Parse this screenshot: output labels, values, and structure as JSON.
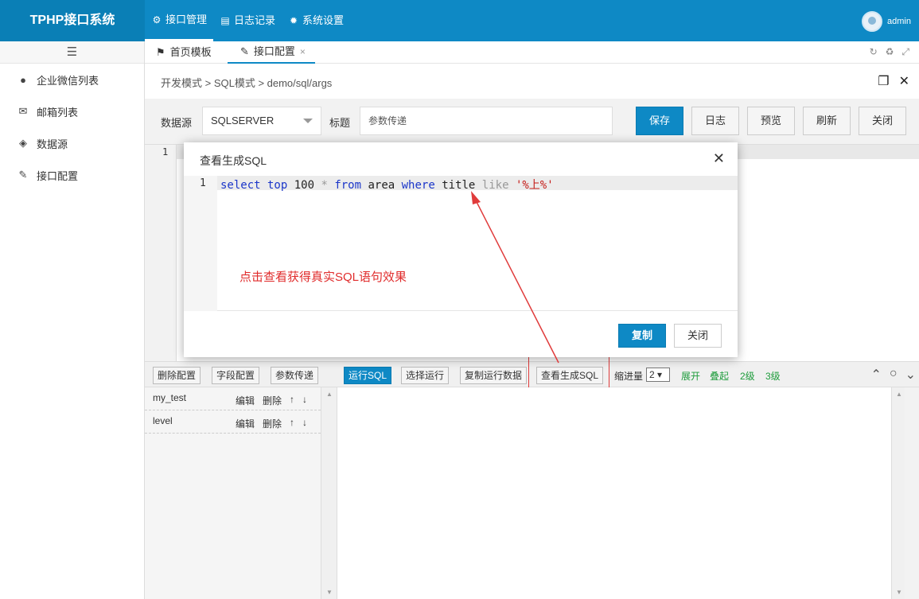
{
  "app": {
    "title": "TPHP接口系统",
    "user": "admin"
  },
  "topnav": [
    {
      "label": "接口管理",
      "icon": "gears-icon",
      "active": true
    },
    {
      "label": "日志记录",
      "icon": "document-icon",
      "active": false
    },
    {
      "label": "系统设置",
      "icon": "gear-icon",
      "active": false
    }
  ],
  "sidebar": {
    "items": [
      {
        "label": "企业微信列表",
        "icon": "wechat-icon"
      },
      {
        "label": "邮箱列表",
        "icon": "envelope-icon"
      },
      {
        "label": "数据源",
        "icon": "cube-icon"
      },
      {
        "label": "接口配置",
        "icon": "wrench-icon"
      }
    ]
  },
  "tabs": [
    {
      "label": "首页模板",
      "icon": "flag-icon"
    },
    {
      "label": "接口配置",
      "icon": "wrench-icon",
      "closable": true
    }
  ],
  "breadcrumb": {
    "text": "开发模式 > SQL模式 > demo/sql/args"
  },
  "form": {
    "datasource_label": "数据源",
    "datasource_value": "SQLSERVER",
    "title_label": "标题",
    "title_value": "参数传递",
    "buttons": {
      "save": "保存",
      "log": "日志",
      "preview": "预览",
      "refresh": "刷新",
      "close": "关闭"
    }
  },
  "editor": {
    "line": "1"
  },
  "modal": {
    "title": "查看生成SQL",
    "line": "1",
    "sql": {
      "t1": "select",
      "t2": " top ",
      "t3": "100",
      "t4": " * ",
      "t5": "from",
      "t6": " area ",
      "t7": "where",
      "t8": " title ",
      "t9": "like",
      "t10": " '%上%'"
    },
    "note": "点击查看获得真实SQL语句效果",
    "copy": "复制",
    "close": "关闭"
  },
  "toolbar": {
    "delete_config": "删除配置",
    "field_config": "字段配置",
    "param_pass": "参数传递",
    "run_sql": "运行SQL",
    "run_selected": "选择运行",
    "copy_run_data": "复制运行数据",
    "view_sql": "查看生成SQL",
    "indent_label": "缩进量",
    "indent_value": "2 ▾",
    "expand": "展开",
    "fold": "叠起",
    "level2": "2级",
    "level3": "3级"
  },
  "params": [
    {
      "name": "my_test",
      "edit": "编辑",
      "delete": "删除",
      "up": "↑",
      "down": "↓"
    },
    {
      "name": "level",
      "edit": "编辑",
      "delete": "删除",
      "up": "↑",
      "down": "↓"
    }
  ],
  "colors": {
    "brand": "#0e89c5",
    "annotation": "#e02c2c",
    "link": "#1e9c3c"
  }
}
